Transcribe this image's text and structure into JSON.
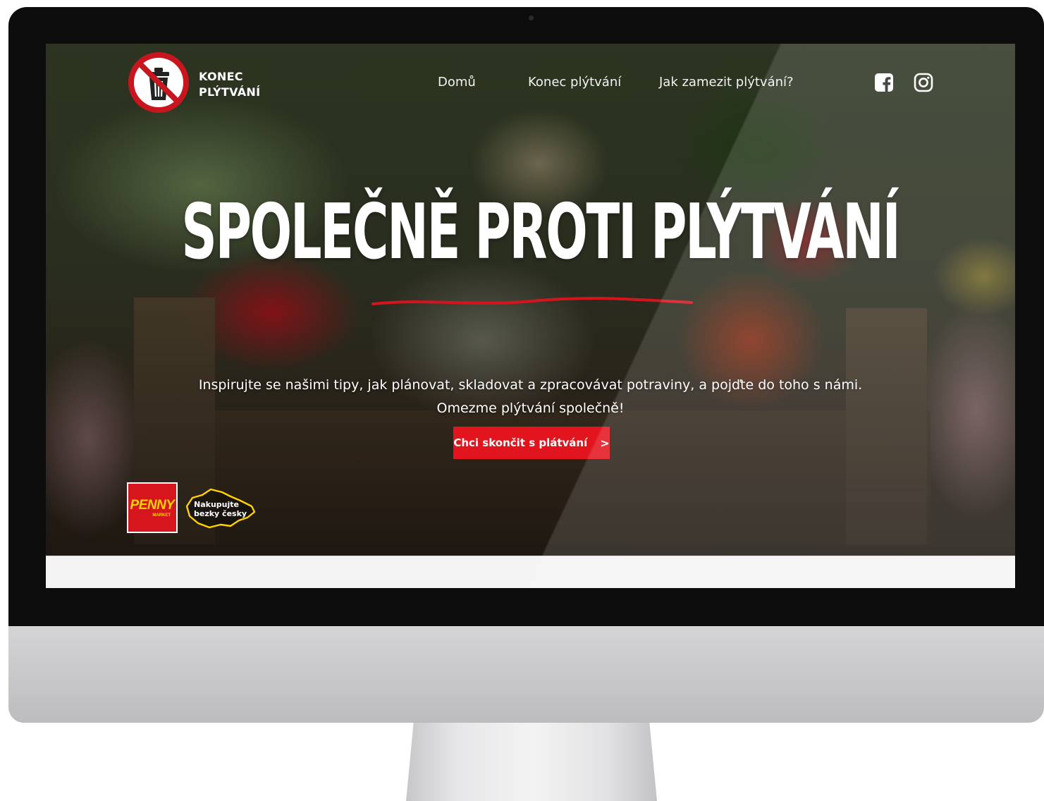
{
  "site": {
    "logo_line1": "KONEC",
    "logo_line2": "PLÝTVÁNÍ"
  },
  "nav": {
    "items": [
      {
        "label": "Domů"
      },
      {
        "label": "Konec plýtvání"
      },
      {
        "label": "Jak zamezit plýtvání?"
      }
    ],
    "social": [
      {
        "icon": "facebook-icon"
      },
      {
        "icon": "instagram-icon"
      }
    ]
  },
  "hero": {
    "title": "SPOLEČNĚ PROTI PLÝTVÁNÍ",
    "subtitle_line1": "Inspirujte se našimi tipy, jak plánovat, skladovat a zpracovávat  potraviny, a pojďte do toho s námi.",
    "subtitle_line2": "Omezme plýtvání společně!",
    "cta_label": "Chci skončit s plátvání",
    "cta_arrow": ">"
  },
  "partners": {
    "penny_word": "PENNY",
    "penny_sub": "MARKET",
    "czech_line1": "Nakupujte",
    "czech_line2": "bezky česky"
  },
  "colors": {
    "brand_red": "#e2141d",
    "logo_red": "#c8161e",
    "penny_yellow": "#ffd200",
    "bezel": "#0d0d0d",
    "chin": "#c6c6c9"
  }
}
